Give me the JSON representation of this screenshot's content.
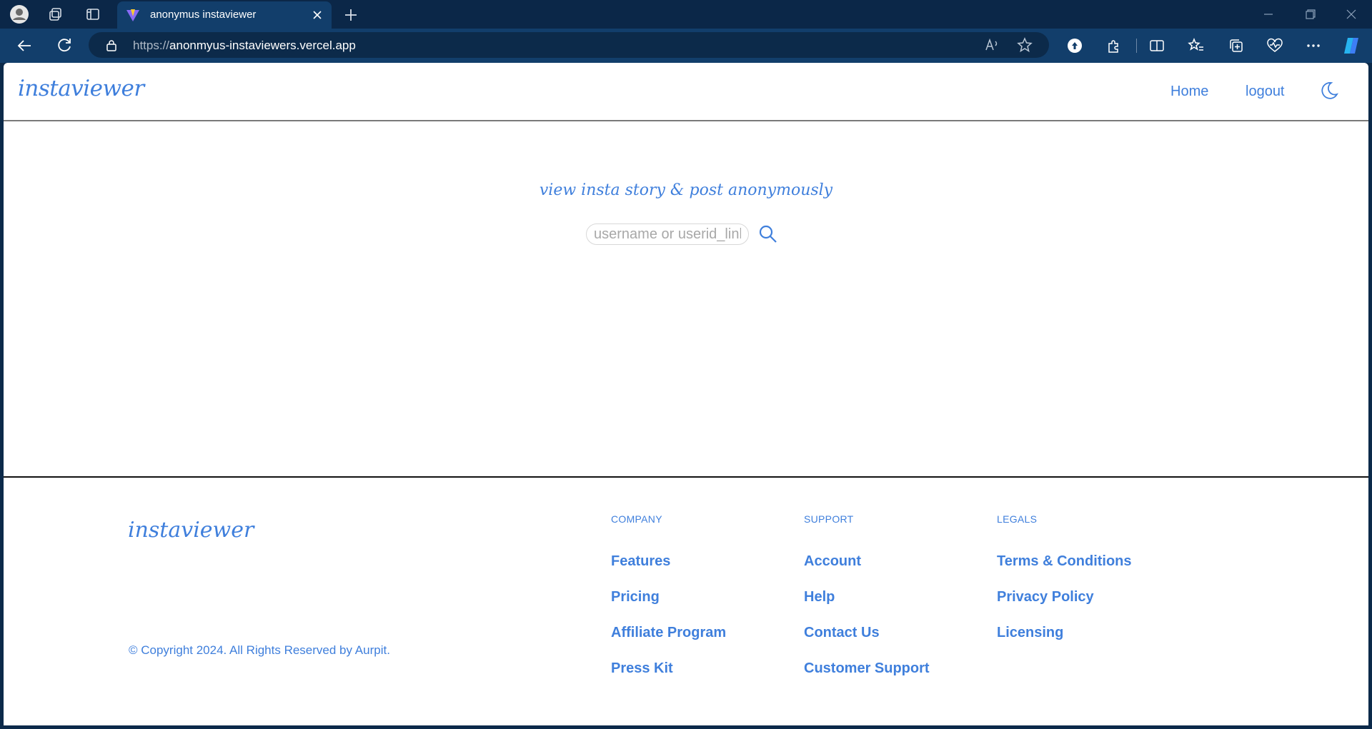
{
  "browser": {
    "tab_title": "anonymus instaviewer",
    "url_protocol": "https://",
    "url_host": "anonmyus-instaviewers.vercel.app"
  },
  "header": {
    "brand": "instaviewer",
    "nav": [
      {
        "label": "Home"
      },
      {
        "label": "logout"
      }
    ],
    "theme_icon": "moon-icon"
  },
  "hero": {
    "tagline": "view insta story & post anonymously",
    "search_placeholder": "username or userid_link",
    "search_icon": "search-icon"
  },
  "footer": {
    "brand": "instaviewer",
    "copyright": "© Copyright 2024. All Rights Reserved by Aurpit.",
    "columns": [
      {
        "heading": "COMPANY",
        "links": [
          "Features",
          "Pricing",
          "Affiliate Program",
          "Press Kit"
        ]
      },
      {
        "heading": "SUPPORT",
        "links": [
          "Account",
          "Help",
          "Contact Us",
          "Customer Support"
        ]
      },
      {
        "heading": "LEGALS",
        "links": [
          "Terms & Conditions",
          "Privacy Policy",
          "Licensing"
        ]
      }
    ]
  },
  "colors": {
    "accent": "#3f7fdc",
    "chrome_dark": "#0b2748",
    "chrome_mid": "#123e6b"
  }
}
